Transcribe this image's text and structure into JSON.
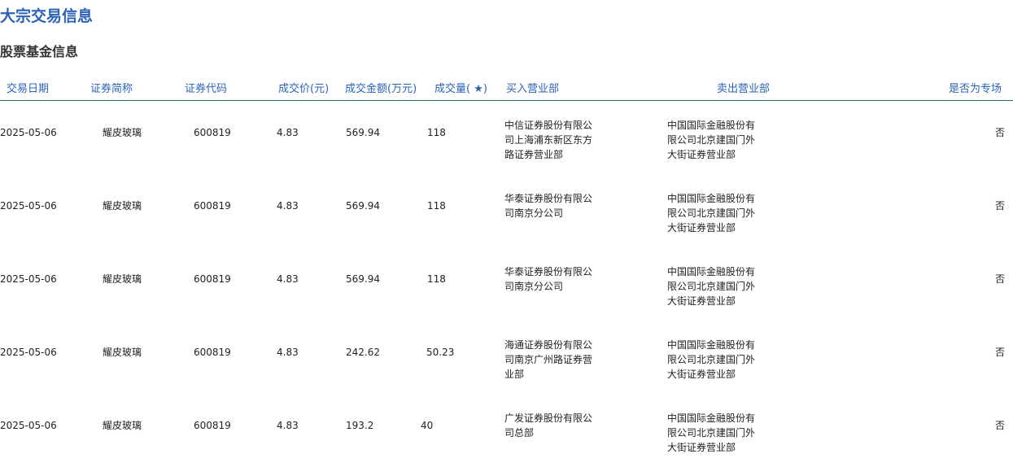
{
  "page_title": "大宗交易信息",
  "section_title": "股票基金信息",
  "table": {
    "headers": {
      "date": "交易日期",
      "name": "证券简称",
      "code": "证券代码",
      "price": "成交价(元)",
      "amount": "成交金额(万元)",
      "volume": "成交量( ★)",
      "buyer": "买入营业部",
      "seller": "卖出营业部",
      "special": "是否为专场"
    },
    "rows": [
      {
        "date": "2025-05-06",
        "name": "耀皮玻璃",
        "code": "600819",
        "price": "4.83",
        "amount": "569.94",
        "volume": "118",
        "buyer": "中信证券股份有限公司上海浦东新区东方路证券营业部",
        "seller": "中国国际金融股份有限公司北京建国门外大街证券营业部",
        "special": "否"
      },
      {
        "date": "2025-05-06",
        "name": "耀皮玻璃",
        "code": "600819",
        "price": "4.83",
        "amount": "569.94",
        "volume": "118",
        "buyer": "华泰证券股份有限公司南京分公司",
        "seller": "中国国际金融股份有限公司北京建国门外大街证券营业部",
        "special": "否"
      },
      {
        "date": "2025-05-06",
        "name": "耀皮玻璃",
        "code": "600819",
        "price": "4.83",
        "amount": "569.94",
        "volume": "118",
        "buyer": "华泰证券股份有限公司南京分公司",
        "seller": "中国国际金融股份有限公司北京建国门外大街证券营业部",
        "special": "否"
      },
      {
        "date": "2025-05-06",
        "name": "耀皮玻璃",
        "code": "600819",
        "price": "4.83",
        "amount": "242.62",
        "volume": "50.23",
        "buyer": "海通证券股份有限公司南京广州路证券营业部",
        "seller": "中国国际金融股份有限公司北京建国门外大街证券营业部",
        "special": "否"
      },
      {
        "date": "2025-05-06",
        "name": "耀皮玻璃",
        "code": "600819",
        "price": "4.83",
        "amount": "193.2",
        "volume": "40",
        "buyer": "广发证券股份有限公司总部",
        "seller": "中国国际金融股份有限公司北京建国门外大街证券营业部",
        "special": "否"
      }
    ]
  }
}
